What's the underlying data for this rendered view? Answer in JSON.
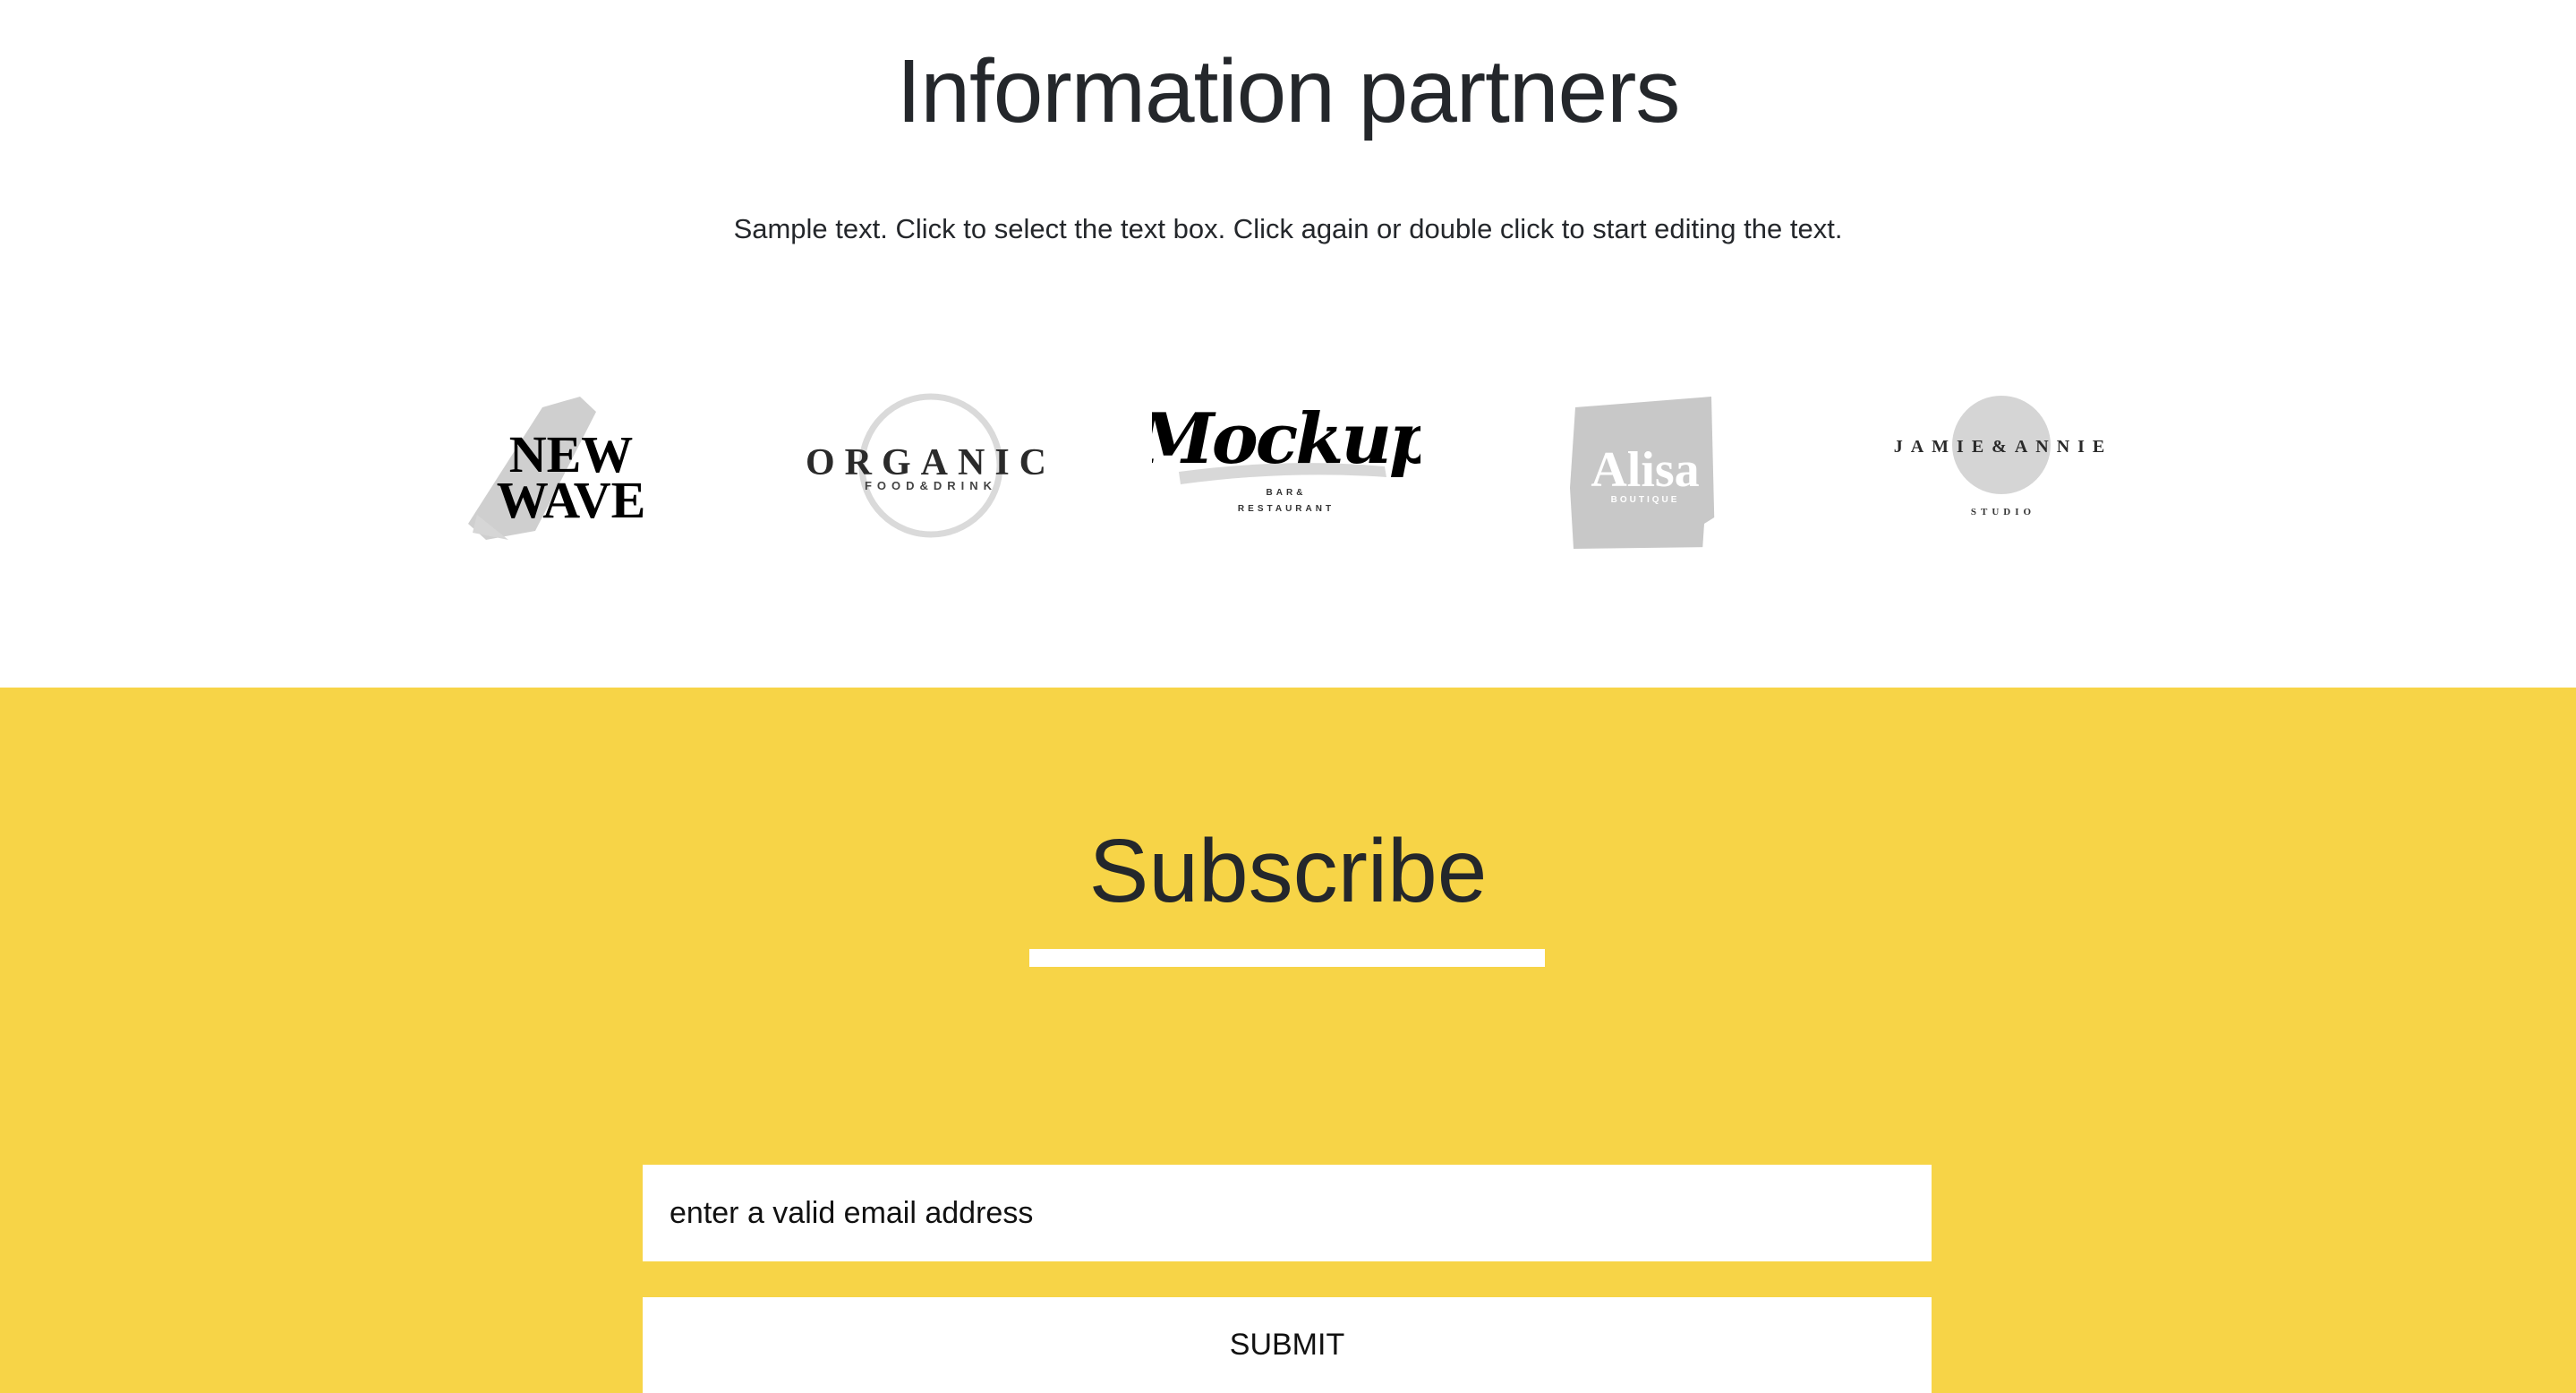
{
  "partners": {
    "title": "Information partners",
    "text": "Sample text. Click to select the text box. Click again or double click to start editing the text.",
    "logos": [
      {
        "name": "new-wave-logo",
        "text_lines": [
          "NEW",
          "WAVE"
        ]
      },
      {
        "name": "organic-logo",
        "text": "ORGANIC",
        "subtext": "FOOD&DRINK"
      },
      {
        "name": "mockup-logo",
        "text": "Mockup",
        "subtext_lines": [
          "BAR&",
          "RESTAURANT"
        ]
      },
      {
        "name": "alisa-logo",
        "text": "Alisa",
        "subtext": "BOUTIQUE"
      },
      {
        "name": "jamie-annie-logo",
        "text": "JAMIE&ANNIE",
        "subtext": "STUDIO"
      }
    ]
  },
  "subscribe": {
    "title": "Subscribe",
    "email_placeholder": "enter a valid email address",
    "submit_label": "SUBMIT",
    "background_color": "#f7d447"
  },
  "colors": {
    "heading": "#24272b",
    "accent": "#f7d447",
    "logo_gray": "#cacaca",
    "underline": "#ffffff"
  }
}
